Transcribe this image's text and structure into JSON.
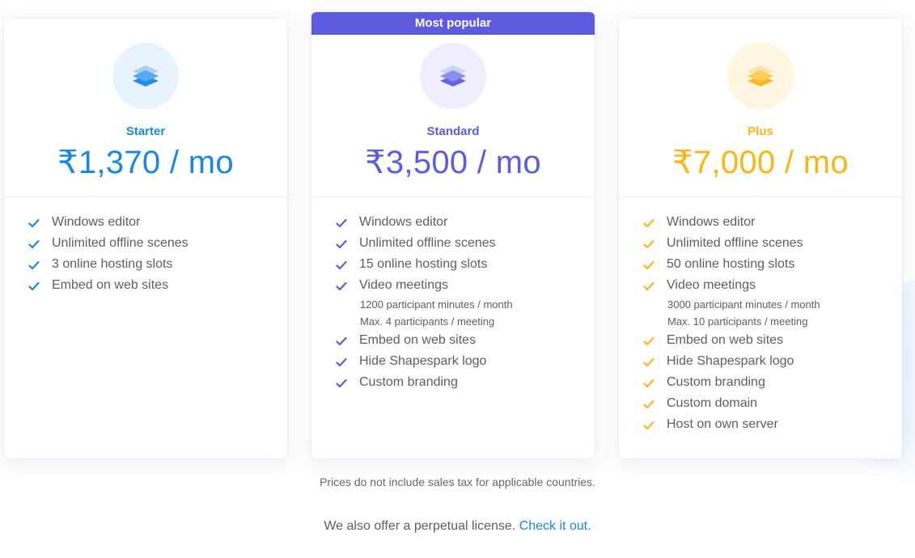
{
  "colors": {
    "starter": "#1a87e6",
    "standard": "#5d5ce0",
    "plus": "#fbb516",
    "text": "#5a5f66",
    "link": "#1a87e6"
  },
  "plans": [
    {
      "id": "starter",
      "name": "Starter",
      "price": "₹1,370 / mo",
      "icon": "layers-icon",
      "features": [
        {
          "label": "Windows editor"
        },
        {
          "label": "Unlimited offline scenes"
        },
        {
          "label": "3 online hosting slots"
        },
        {
          "label": "Embed on web sites"
        }
      ]
    },
    {
      "id": "standard",
      "ribbon": "Most popular",
      "name": "Standard",
      "price": "₹3,500 / mo",
      "icon": "layers-icon",
      "features": [
        {
          "label": "Windows editor"
        },
        {
          "label": "Unlimited offline scenes"
        },
        {
          "label": "15 online hosting slots"
        },
        {
          "label": "Video meetings",
          "details": [
            "1200 participant minutes / month",
            "Max. 4 participants / meeting"
          ]
        },
        {
          "label": "Embed on web sites"
        },
        {
          "label": "Hide Shapespark logo"
        },
        {
          "label": "Custom branding"
        }
      ]
    },
    {
      "id": "plus",
      "name": "Plus",
      "price": "₹7,000 / mo",
      "icon": "layers-icon",
      "features": [
        {
          "label": "Windows editor"
        },
        {
          "label": "Unlimited offline scenes"
        },
        {
          "label": "50 online hosting slots"
        },
        {
          "label": "Video meetings",
          "details": [
            "3000 participant minutes / month",
            "Max. 10 participants / meeting"
          ]
        },
        {
          "label": "Embed on web sites"
        },
        {
          "label": "Hide Shapespark logo"
        },
        {
          "label": "Custom branding"
        },
        {
          "label": "Custom domain"
        },
        {
          "label": "Host on own server"
        }
      ]
    }
  ],
  "footer": {
    "tax_note": "Prices do not include sales tax for applicable countries.",
    "perpetual_text": "We also offer a perpetual license.",
    "perpetual_link": "Check it out."
  }
}
